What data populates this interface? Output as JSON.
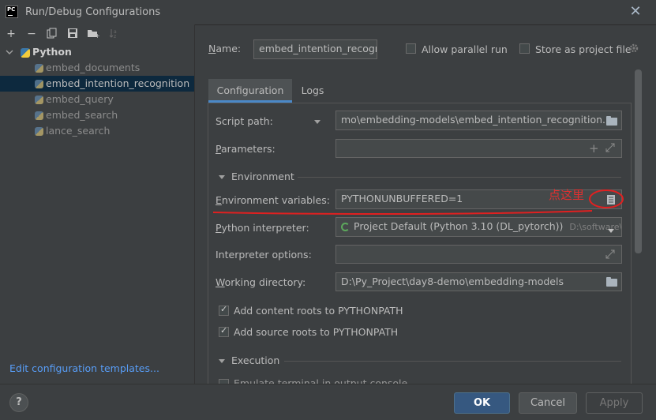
{
  "window": {
    "title": "Run/Debug Configurations",
    "logo_text": "PC"
  },
  "tree": {
    "root": "Python",
    "items": [
      {
        "label": "embed_documents"
      },
      {
        "label": "embed_intention_recognition"
      },
      {
        "label": "embed_query"
      },
      {
        "label": "embed_search"
      },
      {
        "label": "lance_search"
      }
    ]
  },
  "edit_templates": "Edit configuration templates...",
  "name": {
    "label": "Name:",
    "value": "embed_intention_recogni"
  },
  "allow_parallel": {
    "label": "Allow parallel run",
    "checked": false
  },
  "store_as_project": {
    "label": "Store as project file",
    "checked": false
  },
  "tabs": [
    {
      "label": "Configuration"
    },
    {
      "label": "Logs"
    }
  ],
  "form": {
    "script_path_label": "Script path:",
    "script_path_value": "mo\\embedding-models\\embed_intention_recognition.py",
    "parameters_label": "Parameters:",
    "parameters_value": "",
    "environment_section": "Environment",
    "env_vars_label": "Environment variables:",
    "env_vars_value": "PYTHONUNBUFFERED=1",
    "interpreter_label": "Python interpreter:",
    "interpreter_value": "Project Default (Python 3.10 (DL_pytorch))",
    "interpreter_path": "D:\\software\\A",
    "interpreter_options_label": "Interpreter options:",
    "interpreter_options_value": "",
    "working_dir_label": "Working directory:",
    "working_dir_value": "D:\\Py_Project\\day8-demo\\embedding-models",
    "content_roots_label": "Add content roots to PYTHONPATH",
    "source_roots_label": "Add source roots to PYTHONPATH",
    "execution_section": "Execution",
    "execution_partial": "Emulate terminal in output console"
  },
  "annotation": {
    "text": "点这里",
    "color": "#e03030"
  },
  "buttons": {
    "ok": "OK",
    "cancel": "Cancel",
    "apply": "Apply",
    "help": "?"
  },
  "colors": {
    "accent": "#4a88c7",
    "selection": "#0d293e",
    "link": "#589df6",
    "ok_button": "#365880"
  }
}
